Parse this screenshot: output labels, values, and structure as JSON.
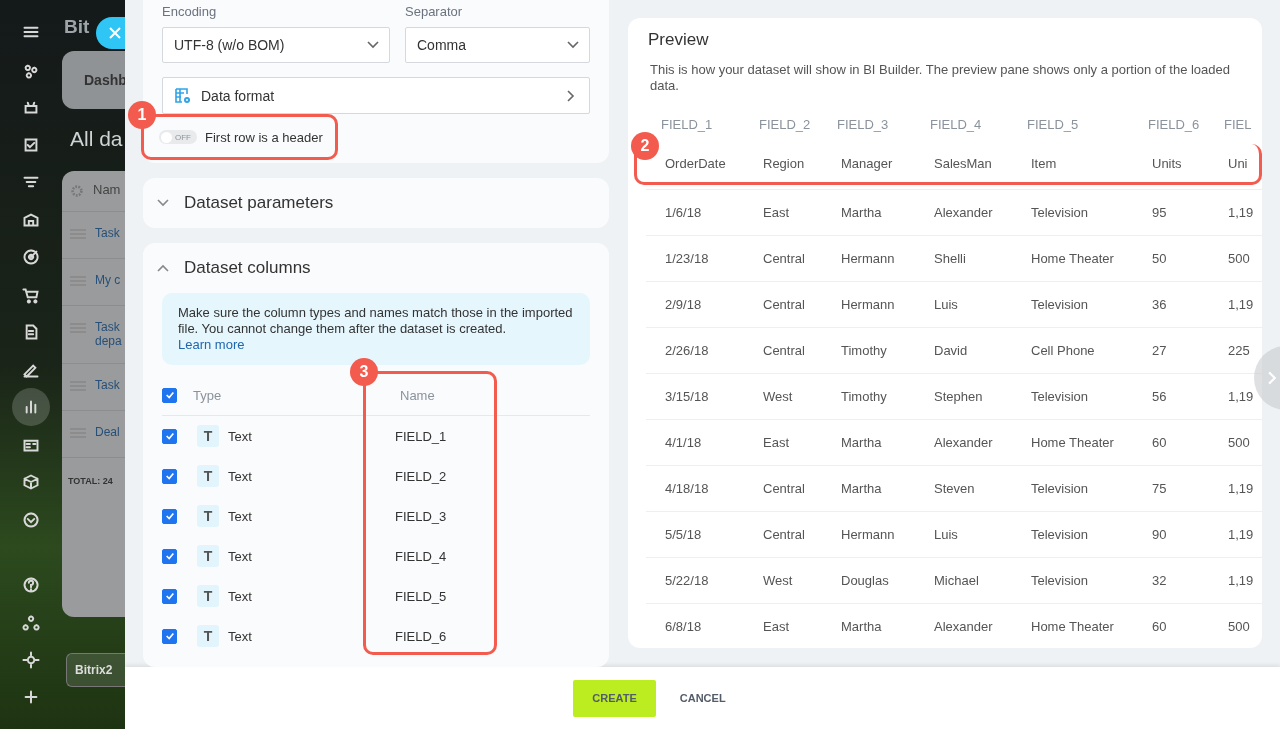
{
  "background_app": {
    "logo": "Bit",
    "tab": "Dashb",
    "heading": "All da",
    "list_header": "Nam",
    "list_items": [
      "Task",
      "My c",
      "Task depa",
      "Task",
      "Deal"
    ],
    "total_label": "TOTAL:",
    "total_value": "24",
    "footer_button": "Bitrix2"
  },
  "sidebar": {
    "items": [
      {
        "selected": false
      },
      {
        "selected": false
      },
      {
        "selected": false
      },
      {
        "selected": false
      },
      {
        "selected": false
      },
      {
        "selected": false
      },
      {
        "selected": false
      },
      {
        "selected": false
      },
      {
        "selected": false
      },
      {
        "selected": false
      },
      {
        "selected": true
      },
      {
        "selected": false
      },
      {
        "selected": false
      },
      {
        "selected": false
      },
      {
        "selected": false
      },
      {
        "selected": false
      },
      {
        "selected": false
      },
      {
        "selected": false
      }
    ]
  },
  "import_settings": {
    "encoding": {
      "label": "Encoding",
      "value": "UTF-8 (w/o BOM)"
    },
    "separator": {
      "label": "Separator",
      "value": "Comma"
    },
    "data_format": "Data format",
    "first_row_header": {
      "label": "First row is a header",
      "on": false,
      "switch_text": "OFF"
    }
  },
  "dataset_parameters": {
    "title": "Dataset parameters",
    "expanded": false
  },
  "dataset_columns": {
    "title": "Dataset columns",
    "expanded": true,
    "notice": "Make sure the column types and names match those in the imported file. You cannot change them after the dataset is created.",
    "notice_link": "Learn more",
    "all_checked": true,
    "type_header": "Type",
    "name_header": "Name",
    "rows": [
      {
        "checked": true,
        "type_icon": "T",
        "type": "Text",
        "name": "FIELD_1"
      },
      {
        "checked": true,
        "type_icon": "T",
        "type": "Text",
        "name": "FIELD_2"
      },
      {
        "checked": true,
        "type_icon": "T",
        "type": "Text",
        "name": "FIELD_3"
      },
      {
        "checked": true,
        "type_icon": "T",
        "type": "Text",
        "name": "FIELD_4"
      },
      {
        "checked": true,
        "type_icon": "T",
        "type": "Text",
        "name": "FIELD_5"
      },
      {
        "checked": true,
        "type_icon": "T",
        "type": "Text",
        "name": "FIELD_6"
      }
    ]
  },
  "preview": {
    "title": "Preview",
    "description": "This is how your dataset will show in BI Builder. The preview pane shows only a portion of the loaded data.",
    "columns": [
      "FIELD_1",
      "FIELD_2",
      "FIELD_3",
      "FIELD_4",
      "FIELD_5",
      "FIELD_6",
      "FIEL"
    ],
    "rows": [
      [
        "OrderDate",
        "Region",
        "Manager",
        "SalesMan",
        "Item",
        "Units",
        "Uni"
      ],
      [
        "1/6/18",
        "East",
        "Martha",
        "Alexander",
        "Television",
        "95",
        "1,19"
      ],
      [
        "1/23/18",
        "Central",
        "Hermann",
        "Shelli",
        "Home Theater",
        "50",
        "500"
      ],
      [
        "2/9/18",
        "Central",
        "Hermann",
        "Luis",
        "Television",
        "36",
        "1,19"
      ],
      [
        "2/26/18",
        "Central",
        "Timothy",
        "David",
        "Cell Phone",
        "27",
        "225"
      ],
      [
        "3/15/18",
        "West",
        "Timothy",
        "Stephen",
        "Television",
        "56",
        "1,19"
      ],
      [
        "4/1/18",
        "East",
        "Martha",
        "Alexander",
        "Home Theater",
        "60",
        "500"
      ],
      [
        "4/18/18",
        "Central",
        "Martha",
        "Steven",
        "Television",
        "75",
        "1,19"
      ],
      [
        "5/5/18",
        "Central",
        "Hermann",
        "Luis",
        "Television",
        "90",
        "1,19"
      ],
      [
        "5/22/18",
        "West",
        "Douglas",
        "Michael",
        "Television",
        "32",
        "1,19"
      ],
      [
        "6/8/18",
        "East",
        "Martha",
        "Alexander",
        "Home Theater",
        "60",
        "500"
      ]
    ]
  },
  "callouts": [
    {
      "number": "1"
    },
    {
      "number": "2"
    },
    {
      "number": "3"
    }
  ],
  "footer": {
    "create": "CREATE",
    "cancel": "CANCEL"
  }
}
